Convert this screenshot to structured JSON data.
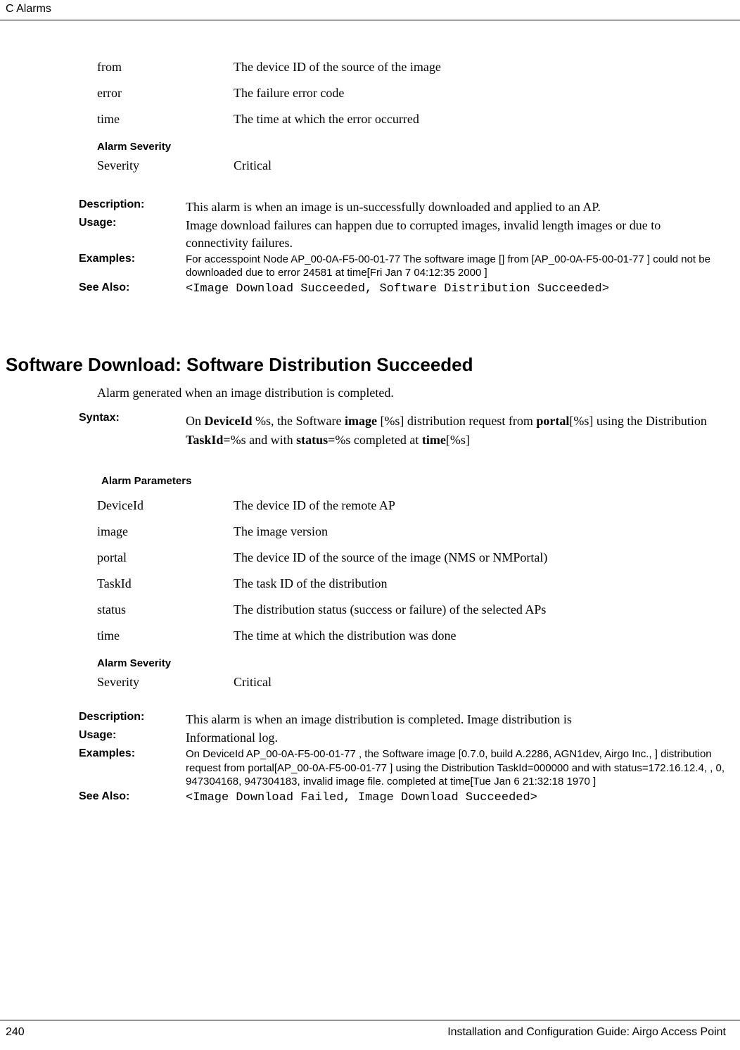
{
  "header": {
    "section": "C  Alarms"
  },
  "alarm1": {
    "params": [
      {
        "name": "from",
        "desc": "The device ID of the source of the image"
      },
      {
        "name": "error",
        "desc": "The failure error code"
      },
      {
        "name": "time",
        "desc": "The time at which the error occurred"
      }
    ],
    "severity_header": "Alarm Severity",
    "severity_label": "Severity",
    "severity_value": "Critical",
    "description_label": "Description:",
    "description_text": "This alarm is when an image is un-successfully downloaded and applied to an AP.",
    "usage_label": "Usage:",
    "usage_text": "Image download failures can happen due to corrupted images, invalid length images or due to connectivity failures.",
    "examples_label": "Examples:",
    "examples_text": "For accesspoint Node AP_00-0A-F5-00-01-77 The software image [] from [AP_00-0A-F5-00-01-77 ] could not be downloaded due to error 24581 at time[Fri Jan 7 04:12:35 2000 ]",
    "seealso_label": "See Also:",
    "seealso_text": "<Image Download Succeeded, Software Distribution Succeeded>"
  },
  "alarm2": {
    "title": "Software Download: Software Distribution Succeeded",
    "intro": "Alarm generated when an image distribution is completed.",
    "syntax_label": "Syntax:",
    "syntax_prefix": "On ",
    "syntax_b1": "DeviceId",
    "syntax_t1": " %s, the Software ",
    "syntax_b2": "image",
    "syntax_t2": " [%s] distribution request from ",
    "syntax_b3": "portal",
    "syntax_t3": "[%s] using the Distribution ",
    "syntax_b4": "TaskId=",
    "syntax_t4": "%s and with ",
    "syntax_b5": "status=",
    "syntax_t5": "%s completed at ",
    "syntax_b6": "time",
    "syntax_t6": "[%s]",
    "param_header": "Alarm Parameters",
    "params": [
      {
        "name": "DeviceId",
        "desc": "The device ID of the remote AP"
      },
      {
        "name": "image",
        "desc": "The image version"
      },
      {
        "name": "portal",
        "desc": "The device ID of the source of the image (NMS or NMPortal)"
      },
      {
        "name": "TaskId",
        "desc": "The task ID of the distribution"
      },
      {
        "name": "status",
        "desc": "The distribution status (success or failure) of the selected APs"
      },
      {
        "name": "time",
        "desc": "The time at which the distribution was done"
      }
    ],
    "severity_header": "Alarm Severity",
    "severity_label": "Severity",
    "severity_value": "Critical",
    "description_label": "Description:",
    "description_text": "This alarm is when an image distribution is completed. Image distribution is",
    "usage_label": "Usage:",
    "usage_text": "Informational log.",
    "examples_label": "Examples:",
    "examples_text": "On DeviceId AP_00-0A-F5-00-01-77 , the Software image [0.7.0, build A.2286, AGN1dev, Airgo Inc., ] distribution request from portal[AP_00-0A-F5-00-01-77 ] using the Distribution TaskId=000000 and with status=172.16.12.4, , 0, 947304168, 947304183, invalid image file. completed at time[Tue Jan 6 21:32:18 1970 ]",
    "seealso_label": "See Also:",
    "seealso_text": "<Image Download Failed, Image Download Succeeded>"
  },
  "footer": {
    "page": "240",
    "title": "Installation and Configuration Guide: Airgo Access Point"
  }
}
